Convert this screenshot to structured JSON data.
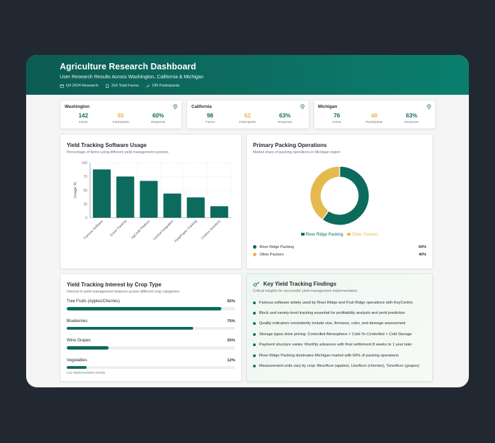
{
  "header": {
    "title": "Agriculture Research Dashboard",
    "subtitle": "User Research Results Across Washington, California & Michigan",
    "meta": [
      "Q4 2024 Research",
      "316 Total Farms",
      "195 Participants"
    ]
  },
  "states": [
    {
      "name": "Washington",
      "farms": "142",
      "participants": "85",
      "response": "60%"
    },
    {
      "name": "California",
      "farms": "98",
      "participants": "62",
      "response": "63%"
    },
    {
      "name": "Michigan",
      "farms": "76",
      "participants": "48",
      "response": "63%"
    }
  ],
  "stat_labels": {
    "farms": "Farms",
    "participants": "Participants",
    "response": "Response"
  },
  "software_usage": {
    "title": "Yield Tracking Software Usage",
    "desc": "Percentage of farms using different yield management systems"
  },
  "packing": {
    "title": "Primary Packing Operations",
    "desc": "Market share of packing operations in Michigan region",
    "rows": [
      {
        "label": "River Ridge Packing",
        "value": "60%"
      },
      {
        "label": "Other Packers",
        "value": "40%"
      }
    ]
  },
  "crop_interest": {
    "title": "Yield Tracking Interest by Crop Type",
    "desc": "Interest in yield management features across different crop categories",
    "items": [
      {
        "label": "Tree Fruits (Apples/Cherries)",
        "pct": "92%",
        "value": 92
      },
      {
        "label": "Blueberries",
        "pct": "75%",
        "value": 75
      },
      {
        "label": "Wine Grapes",
        "pct": "25%",
        "value": 25
      },
      {
        "label": "Vegetables",
        "pct": "12%",
        "value": 12
      }
    ],
    "note": "Low implementation priority"
  },
  "findings": {
    "title": "Key Yield Tracking Findings",
    "desc": "Critical insights for successful yield management implementation",
    "items": [
      "Famous software widely used by River Ridge and Fruit Ridge operations with KeyCentrix",
      "Block and variety-level tracking essential for profitability analysis and yield prediction",
      "Quality indicators consistently include size, firmness, color, and damage assessment",
      "Storage types drive pricing: Controlled Atmosphere > Cold-To-Controlled > Cold Storage",
      "Payment structure varies: Monthly advances with final settlement 8 weeks to 1 year later",
      "River Ridge Packing dominates Michigan market with 60% of packing operations",
      "Measurement units vary by crop: Bins/Acre (apples), Lbs/Acre (cherries), Tons/Acre (grapes)"
    ]
  },
  "colors": {
    "teal": "#0d6b5e",
    "amber": "#e6b94e",
    "header": "#0c5c53"
  },
  "chart_data": [
    {
      "type": "bar",
      "ylabel": "Usage %",
      "ylim": [
        0,
        100
      ],
      "yticks": [
        0,
        25,
        50,
        75,
        100
      ],
      "categories": [
        "Famous Software",
        "Excel Tracking",
        "AgCode Platform",
        "Central Integration",
        "Field/Paper Tracking",
        "Custom Solutions"
      ],
      "values": [
        88,
        75,
        67,
        44,
        37,
        21
      ]
    },
    {
      "type": "pie",
      "donut": true,
      "categories": [
        "River Ridge Packing",
        "Other Packers"
      ],
      "values": [
        60,
        40
      ],
      "legend": "bottom"
    }
  ]
}
